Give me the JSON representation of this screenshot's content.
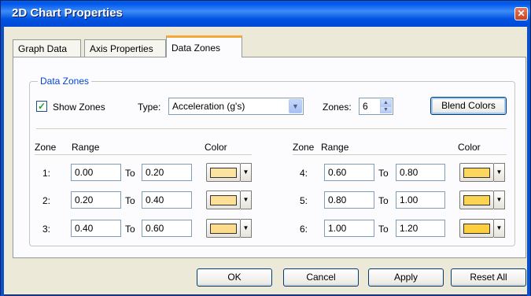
{
  "window": {
    "title": "2D Chart Properties"
  },
  "tabs": [
    {
      "label": "Graph Data"
    },
    {
      "label": "Axis Properties"
    },
    {
      "label": "Data Zones"
    }
  ],
  "group": {
    "title": "Data Zones",
    "show_zones_label": "Show Zones",
    "show_zones_checked": "✓",
    "type_label": "Type:",
    "type_value": "Acceleration (g's)",
    "zones_label": "Zones:",
    "zones_value": "6",
    "blend_button": "Blend Colors",
    "headers": {
      "zone": "Zone",
      "range": "Range",
      "color": "Color",
      "to": "To"
    },
    "rows": [
      {
        "zone": "1:",
        "from": "0.00",
        "to": "0.20",
        "color": "#fde3a0"
      },
      {
        "zone": "2:",
        "from": "0.20",
        "to": "0.40",
        "color": "#fde098"
      },
      {
        "zone": "3:",
        "from": "0.40",
        "to": "0.60",
        "color": "#fcdc8a"
      },
      {
        "zone": "4:",
        "from": "0.60",
        "to": "0.80",
        "color": "#fdd65e"
      },
      {
        "zone": "5:",
        "from": "0.80",
        "to": "1.00",
        "color": "#fdd452"
      },
      {
        "zone": "6:",
        "from": "1.00",
        "to": "1.20",
        "color": "#fdce3e"
      }
    ]
  },
  "buttons": {
    "ok": "OK",
    "cancel": "Cancel",
    "apply": "Apply",
    "reset": "Reset All"
  },
  "icons": {
    "close": "close-icon",
    "dropdown": "chevron-down-icon",
    "spin_up": "chevron-up-icon",
    "spin_down": "chevron-down-icon"
  }
}
